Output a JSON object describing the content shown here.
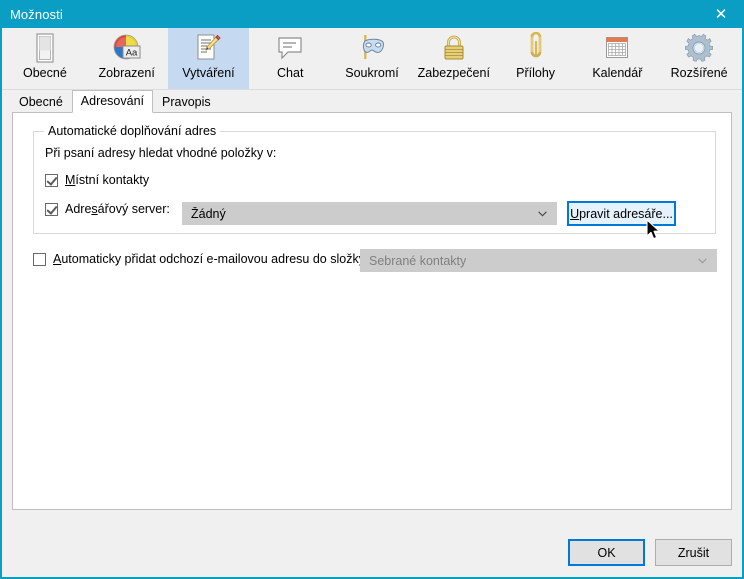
{
  "window": {
    "title": "Možnosti",
    "close_label": "✕",
    "accent_color": "#0a9ec4",
    "selection_color": "#c5d9f1",
    "focus_color": "#0078d7"
  },
  "toolbar": {
    "items": [
      {
        "label": "Obecné",
        "icon": "general-window-icon",
        "selected": false
      },
      {
        "label": "Zobrazení",
        "icon": "color-wheel-aa-icon",
        "selected": false
      },
      {
        "label": "Vytváření",
        "icon": "document-pencil-icon",
        "selected": true
      },
      {
        "label": "Chat",
        "icon": "speech-bubble-icon",
        "selected": false
      },
      {
        "label": "Soukromí",
        "icon": "mask-icon",
        "selected": false
      },
      {
        "label": "Zabezpečení",
        "icon": "padlock-icon",
        "selected": false
      },
      {
        "label": "Přílohy",
        "icon": "paperclip-icon",
        "selected": false
      },
      {
        "label": "Kalendář",
        "icon": "calendar-icon",
        "selected": false
      },
      {
        "label": "Rozšířené",
        "icon": "gear-icon",
        "selected": false
      }
    ]
  },
  "tabs": [
    {
      "label": "Obecné",
      "active": false
    },
    {
      "label": "Adresování",
      "active": true
    },
    {
      "label": "Pravopis",
      "active": false
    }
  ],
  "group": {
    "title": "Automatické doplňování adres",
    "hint": "Při psaní adresy hledat vhodné položky v:",
    "local_contacts": {
      "label_pre": "",
      "label_accel": "M",
      "label_post": "ístní kontakty",
      "checked": true
    },
    "directory_server": {
      "label_pre": "Adre",
      "label_accel": "s",
      "label_post": "ářový server:",
      "checked": true,
      "value": "Žádný"
    },
    "edit_directories_button": "Upravit adresáře...",
    "edit_directories_accel": "U",
    "edit_directories_rest": "pravit adresáře..."
  },
  "auto_add": {
    "label_accel": "A",
    "label_rest": "utomaticky přidat odchozí e-mailovou adresu do složky:",
    "checked": false,
    "value": "Sebrané kontakty",
    "disabled": true
  },
  "footer": {
    "ok_label": "OK",
    "cancel_label": "Zrušit"
  }
}
